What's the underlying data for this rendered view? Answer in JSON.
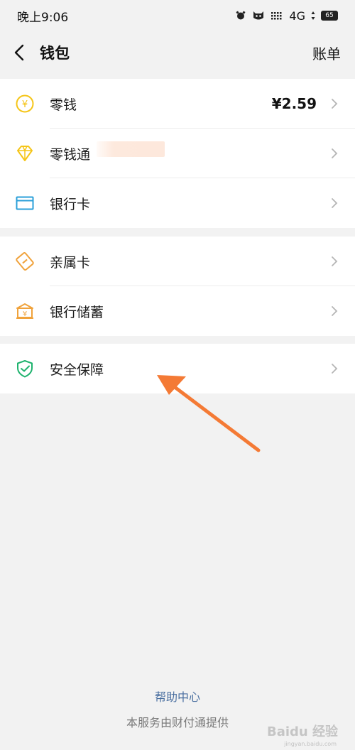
{
  "status_bar": {
    "time": "晚上9:06",
    "network": "4G",
    "battery": "65"
  },
  "header": {
    "title": "钱包",
    "bill_link": "账单"
  },
  "groups": [
    {
      "items": [
        {
          "label": "零钱",
          "value": "¥2.59",
          "icon": "yuan-coin-icon",
          "color": "#f5c518"
        },
        {
          "label": "零钱通",
          "icon": "diamond-icon",
          "color": "#f5c518"
        },
        {
          "label": "银行卡",
          "icon": "bank-card-icon",
          "color": "#2a9fd8"
        }
      ]
    },
    {
      "items": [
        {
          "label": "亲属卡",
          "icon": "family-card-icon",
          "color": "#f0a23b"
        },
        {
          "label": "银行储蓄",
          "icon": "bank-savings-icon",
          "color": "#f0a23b"
        }
      ]
    },
    {
      "items": [
        {
          "label": "安全保障",
          "icon": "shield-check-icon",
          "color": "#1fb36e"
        }
      ]
    }
  ],
  "annotation": {
    "arrow_color": "#f47a35"
  },
  "footer": {
    "help": "帮助中心",
    "provider": "本服务由财付通提供"
  },
  "watermark": {
    "text": "Baidu 经验",
    "sub": "jingyan.baidu.com"
  }
}
